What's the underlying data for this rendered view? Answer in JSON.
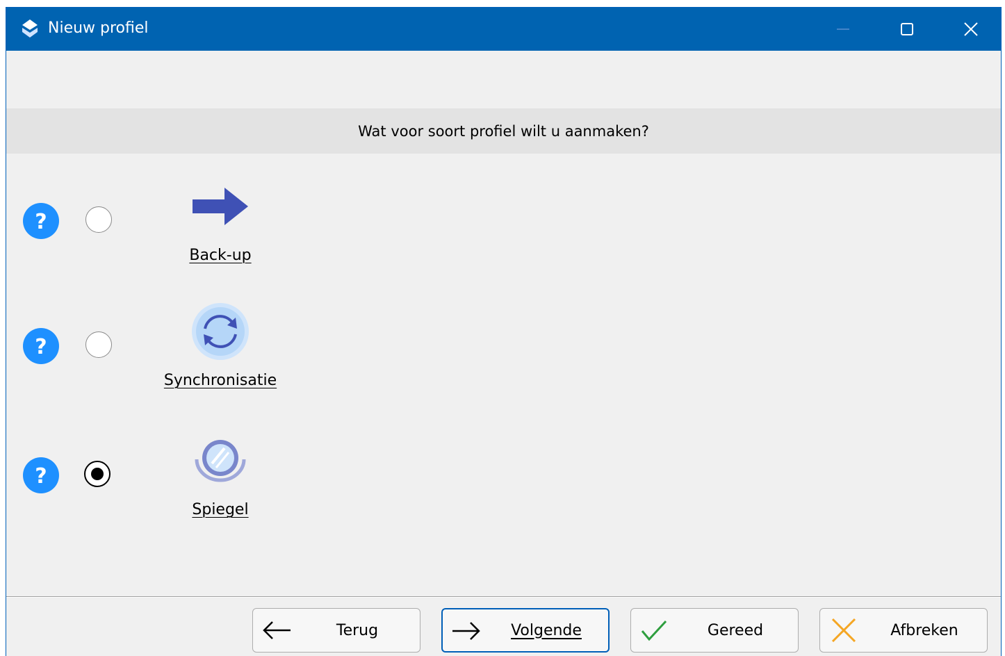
{
  "window": {
    "title": "Nieuw profiel",
    "controls": {
      "minimize": "minimize-icon",
      "maximize": "maximize-icon",
      "close": "close-icon"
    }
  },
  "question": "Wat voor soort profiel wilt u aanmaken?",
  "options": [
    {
      "label": "Back-up",
      "icon": "arrow-right-icon",
      "selected": false
    },
    {
      "label": "Synchronisatie",
      "icon": "sync-icon",
      "selected": false
    },
    {
      "label": "Spiegel",
      "icon": "mirror-icon",
      "selected": true
    }
  ],
  "buttons": {
    "back": "Terug",
    "next": "Volgende",
    "finish": "Gereed",
    "cancel": "Afbreken"
  },
  "colors": {
    "titlebar": "#0063b1",
    "help": "#1e90ff",
    "accent": "#005fb8",
    "backup_arrow": "#3f51b5",
    "finish_check": "#2e9e3e",
    "cancel_x": "#f5a623"
  }
}
